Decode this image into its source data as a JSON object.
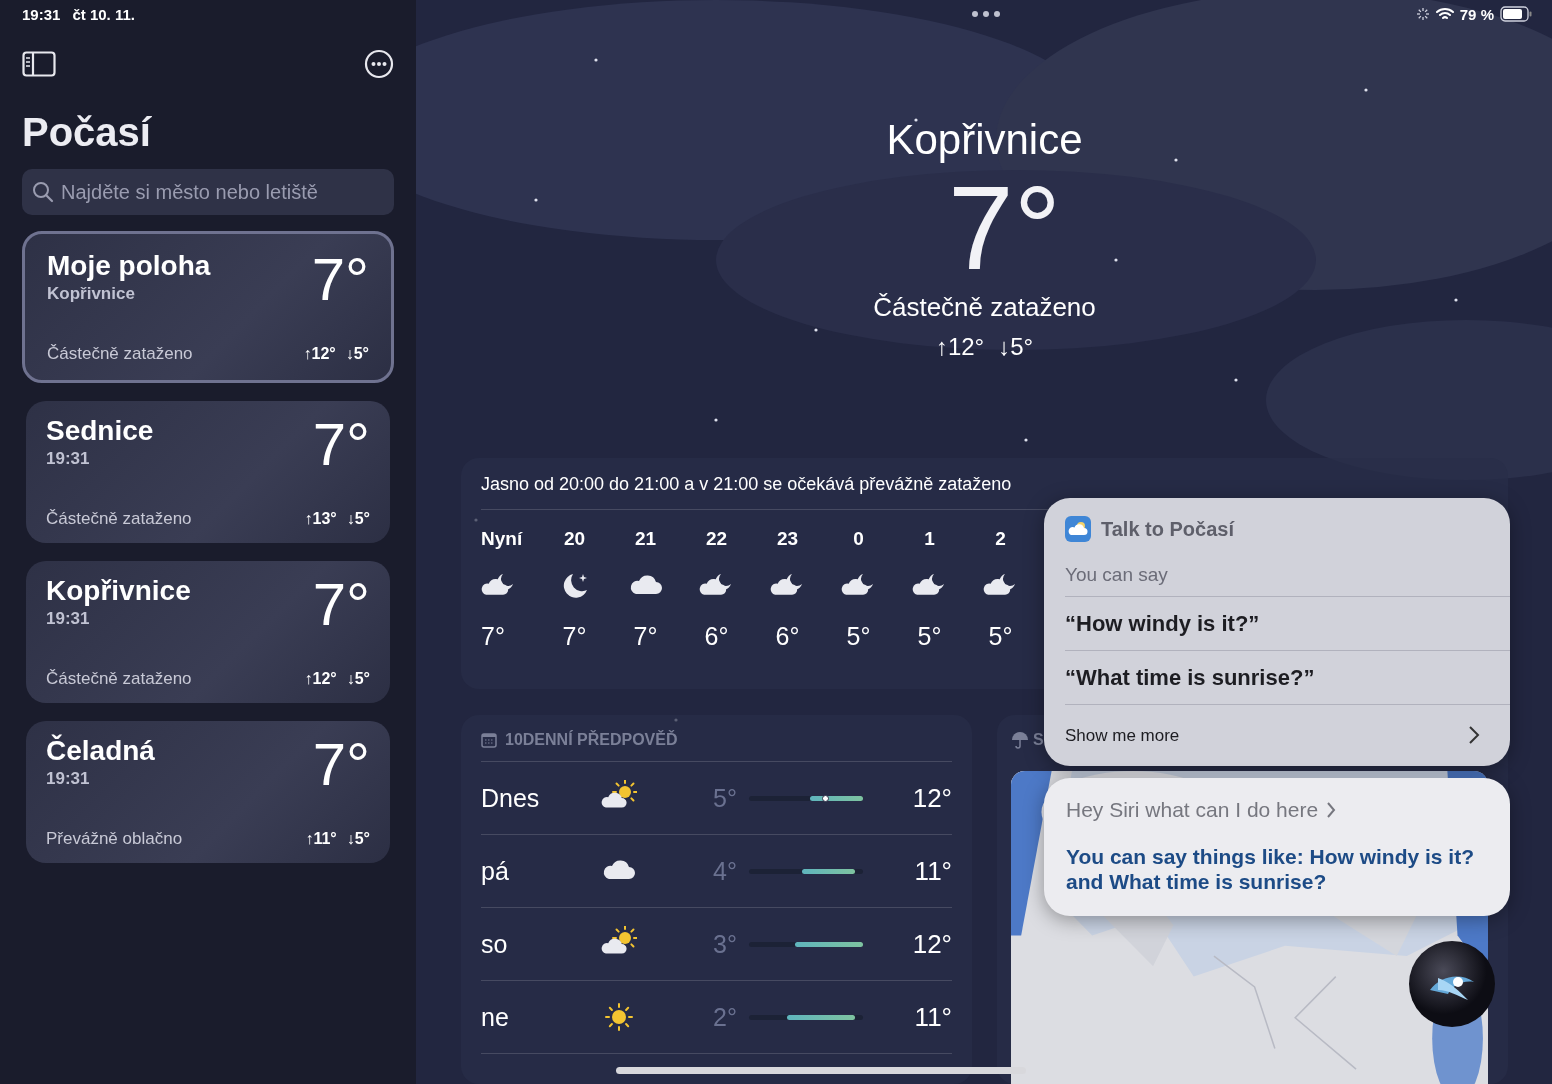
{
  "status_bar": {
    "time": "19:31",
    "date": "čt 10. 11.",
    "battery": "79 %"
  },
  "sidebar": {
    "title": "Počasí",
    "search": {
      "placeholder": "Najděte si město nebo letiště"
    },
    "locations": [
      {
        "name": "Moje poloha",
        "subtitle": "Kopřivnice",
        "temperature": "7°",
        "condition": "Částečně zataženo",
        "high": "↑12°",
        "low": "↓5°",
        "selected": true
      },
      {
        "name": "Sednice",
        "subtitle": "19:31",
        "temperature": "7°",
        "condition": "Částečně zataženo",
        "high": "↑13°",
        "low": "↓5°",
        "selected": false
      },
      {
        "name": "Kopřivnice",
        "subtitle": "19:31",
        "temperature": "7°",
        "condition": "Částečně zataženo",
        "high": "↑12°",
        "low": "↓5°",
        "selected": false
      },
      {
        "name": "Čeladná",
        "subtitle": "19:31",
        "temperature": "7°",
        "condition": "Převážně oblačno",
        "high": "↑11°",
        "low": "↓5°",
        "selected": false
      }
    ]
  },
  "current": {
    "city": "Kopřivnice",
    "temperature": "7°",
    "condition": "Částečně zataženo",
    "high": "↑12°",
    "low": "↓5°"
  },
  "hourly": {
    "summary": "Jasno od 20:00 do 21:00 a v 21:00 se očekává převážně zataženo",
    "hours": [
      {
        "label": "Nyní",
        "kind": "cloud-moon",
        "temperature": "7°"
      },
      {
        "label": "20",
        "kind": "moon",
        "temperature": "7°"
      },
      {
        "label": "21",
        "kind": "cloud",
        "temperature": "7°"
      },
      {
        "label": "22",
        "kind": "cloud-moon",
        "temperature": "6°"
      },
      {
        "label": "23",
        "kind": "cloud-moon",
        "temperature": "6°"
      },
      {
        "label": "0",
        "kind": "cloud-moon",
        "temperature": "5°"
      },
      {
        "label": "1",
        "kind": "cloud-moon",
        "temperature": "5°"
      },
      {
        "label": "2",
        "kind": "cloud-moon",
        "temperature": "5°"
      }
    ]
  },
  "daily": {
    "title": "10DENNÍ PŘEDPOVĚĎ",
    "days": [
      {
        "day": "Dnes",
        "kind": "cloud-sun",
        "low": "5°",
        "high": "12°",
        "today": true
      },
      {
        "day": "pá",
        "kind": "cloud",
        "low": "4°",
        "high": "11°",
        "today": false
      },
      {
        "day": "so",
        "kind": "cloud-sun",
        "low": "3°",
        "high": "12°",
        "today": false
      },
      {
        "day": "ne",
        "kind": "sun",
        "low": "2°",
        "high": "11°",
        "today": false
      }
    ]
  },
  "precipitation": {
    "title": "S"
  },
  "siri": {
    "app_title": "Talk to Počasí",
    "intro": "You can say",
    "suggestions": [
      "“How windy is it?”",
      "“What time is sunrise?”"
    ],
    "more": "Show me more",
    "query": "Hey Siri what can I do here",
    "answer": "You can say things like: How windy is it? and What time is sunrise?"
  }
}
